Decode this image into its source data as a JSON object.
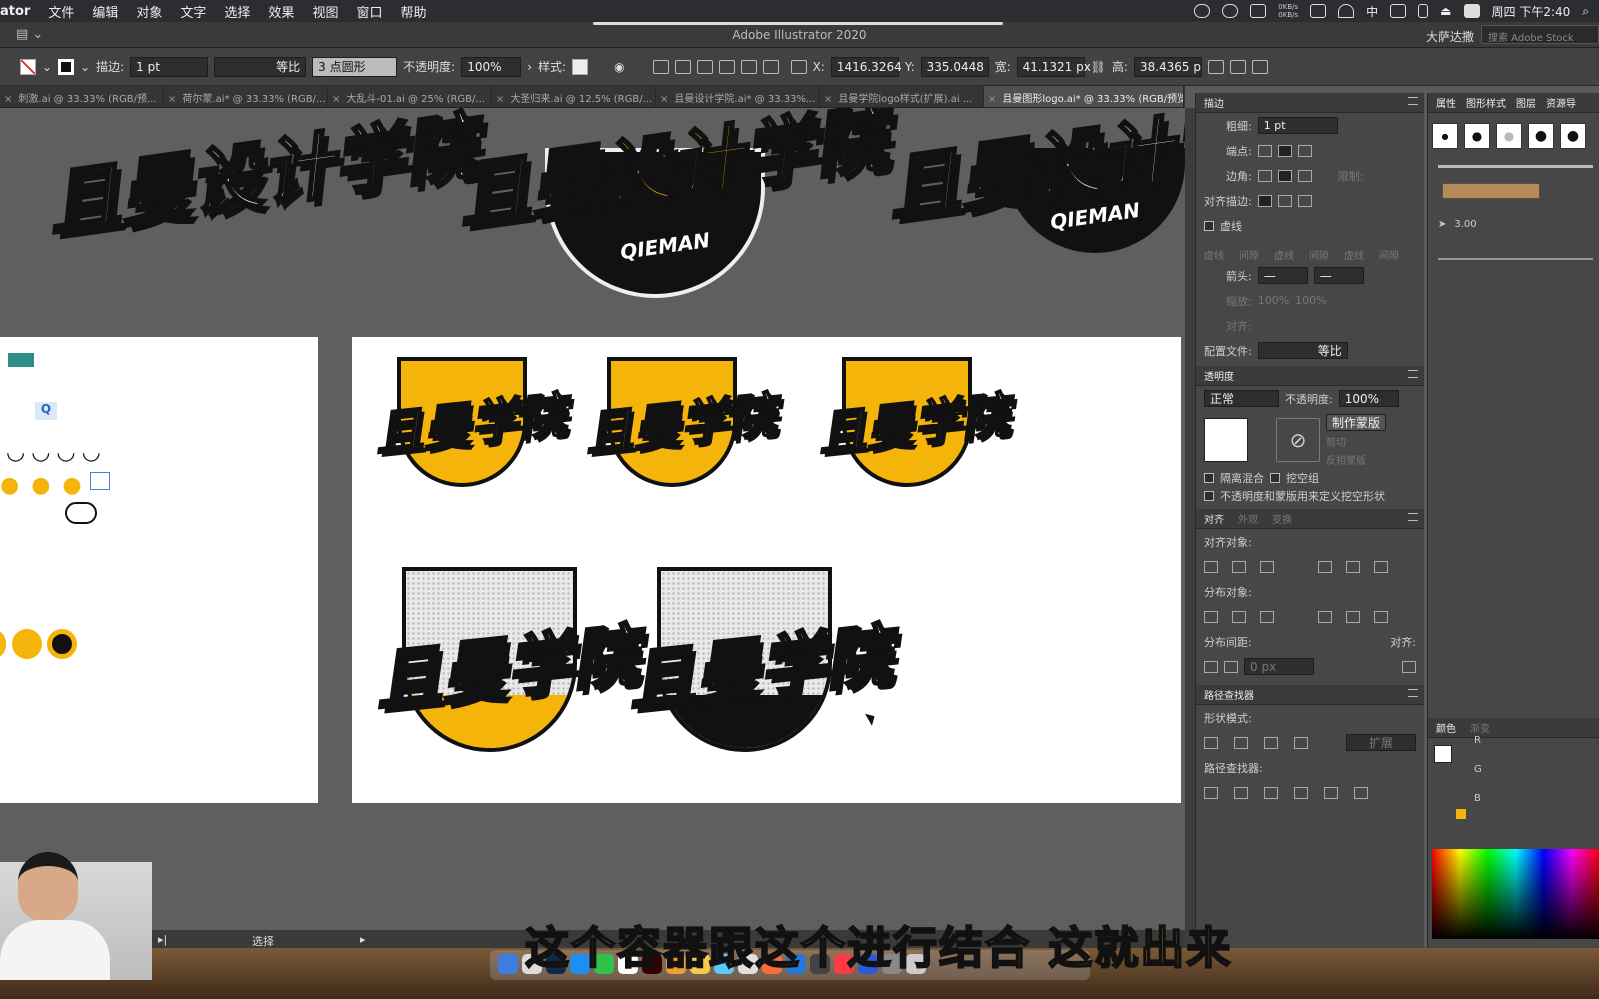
{
  "menubar": {
    "app": "ator",
    "items": [
      "文件",
      "编辑",
      "对象",
      "文字",
      "选择",
      "效果",
      "视图",
      "窗口",
      "帮助"
    ],
    "netspeed_up": "0KB/s",
    "netspeed_down": "0KB/s",
    "input_method": "中",
    "clock": "周四 下午2:40"
  },
  "titlebar": {
    "title": "Adobe Illustrator 2020",
    "workspace": "大萨达撒",
    "search_placeholder": "搜索 Adobe Stock"
  },
  "control": {
    "stroke_label": "描边:",
    "stroke_value": "1 pt",
    "stroke_profile": "等比",
    "brush": "3 点圆形",
    "opacity_label": "不透明度:",
    "opacity_value": "100%",
    "style_label": "样式:",
    "x_label": "X:",
    "x_value": "1416.3264",
    "y_label": "Y:",
    "y_value": "335.0448",
    "w_label": "宽:",
    "w_value": "41.1321 px",
    "h_label": "高:",
    "h_value": "38.4365 p"
  },
  "tabs": [
    {
      "label": "刺激.ai @ 33.33% (RGB/预..."
    },
    {
      "label": "荷尔蒙.ai* @ 33.33% (RGB/..."
    },
    {
      "label": "大乱斗-01.ai @ 25% (RGB/..."
    },
    {
      "label": "大圣归来.ai @ 12.5% (RGB/..."
    },
    {
      "label": "且曼设计学院.ai* @ 33.33%..."
    },
    {
      "label": "且曼学院logo样式(扩展).ai ..."
    },
    {
      "label": "且曼图形logo.ai* @ 33.33% (RGB/预览)"
    }
  ],
  "artwork": {
    "wordmark_full": "且曼设计学院",
    "wordmark_cut": "且曼设计学",
    "wordmark_short": "且曼学院",
    "badge_text": "QIEMAN"
  },
  "stroke_panel": {
    "title": "描边",
    "weight_label": "粗细:",
    "weight_value": "1 pt",
    "cap_label": "端点:",
    "corner_label": "边角:",
    "limit_label": "限制:",
    "align_label": "对齐描边:",
    "dashed_label": "虚线",
    "dash_cols": [
      "虚线",
      "间隙",
      "虚线",
      "间隙",
      "虚线",
      "间隙"
    ],
    "arrow_label": "箭头:",
    "scale_label": "缩放:",
    "scale_value": "100%",
    "align2_label": "对齐:",
    "profile_label": "配置文件:",
    "profile_value": "等比"
  },
  "transparency_panel": {
    "title": "透明度",
    "mode": "正常",
    "opacity_label": "不透明度:",
    "opacity_value": "100%",
    "make_mask": "制作蒙版",
    "clip": "剪切",
    "invert": "反相蒙版",
    "isolate": "隔离混合",
    "knockout": "挖空组",
    "opacity_mask": "不透明度和蒙版用来定义挖空形状"
  },
  "align_panel": {
    "tabs": [
      "对齐",
      "外观",
      "变换"
    ],
    "align_objects": "对齐对象:",
    "distribute_objects": "分布对象:",
    "distribute_spacing": "分布间距:",
    "align_to": "对齐:",
    "spacing_value": "0 px"
  },
  "pathfinder_panel": {
    "title": "路径查找器",
    "shape_modes": "形状模式:",
    "expand": "扩展",
    "pathfinders": "路径查找器:"
  },
  "far_panel": {
    "tabs": [
      "属性",
      "图形样式",
      "图层",
      "资源导"
    ],
    "brush_value": "3.00",
    "color_tabs": [
      "颜色",
      "渐变"
    ],
    "channels": [
      "R",
      "G",
      "B"
    ]
  },
  "statusbar": {
    "zoom_hint": "选择"
  },
  "subtitle": "这个容器跟这个进行结合  这就出来",
  "colors": {
    "accent_yellow": "#f5b40a",
    "brand_black": "#111111"
  }
}
